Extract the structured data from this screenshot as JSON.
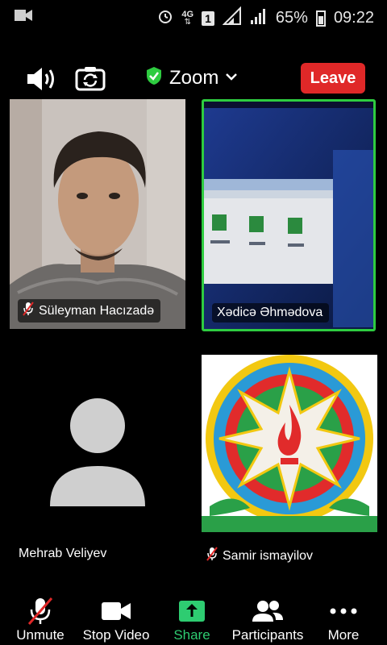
{
  "status_bar": {
    "network": "4G",
    "sim": "1",
    "battery_percent": "65%",
    "time": "09:22"
  },
  "top_bar": {
    "meeting_title": "Zoom",
    "leave_label": "Leave",
    "colors": {
      "leave": "#e02828",
      "secure": "#2ecc40"
    }
  },
  "participants": [
    {
      "name": "Süleyman Hacızadə",
      "muted": true,
      "video": "camera"
    },
    {
      "name": "Xədicə Əhmədova",
      "muted": false,
      "active_speaker": true,
      "video": "screen-capture"
    },
    {
      "name": "Mehrab Veliyev",
      "muted": false,
      "video": "avatar"
    },
    {
      "name": "Samir ismayilov",
      "muted": true,
      "video": "emblem"
    }
  ],
  "toolbar": {
    "unmute_label": "Unmute",
    "stop_video_label": "Stop Video",
    "share_label": "Share",
    "participants_label": "Participants",
    "more_label": "More",
    "colors": {
      "share": "#2ecc71",
      "muted_slash": "#e02828"
    }
  }
}
